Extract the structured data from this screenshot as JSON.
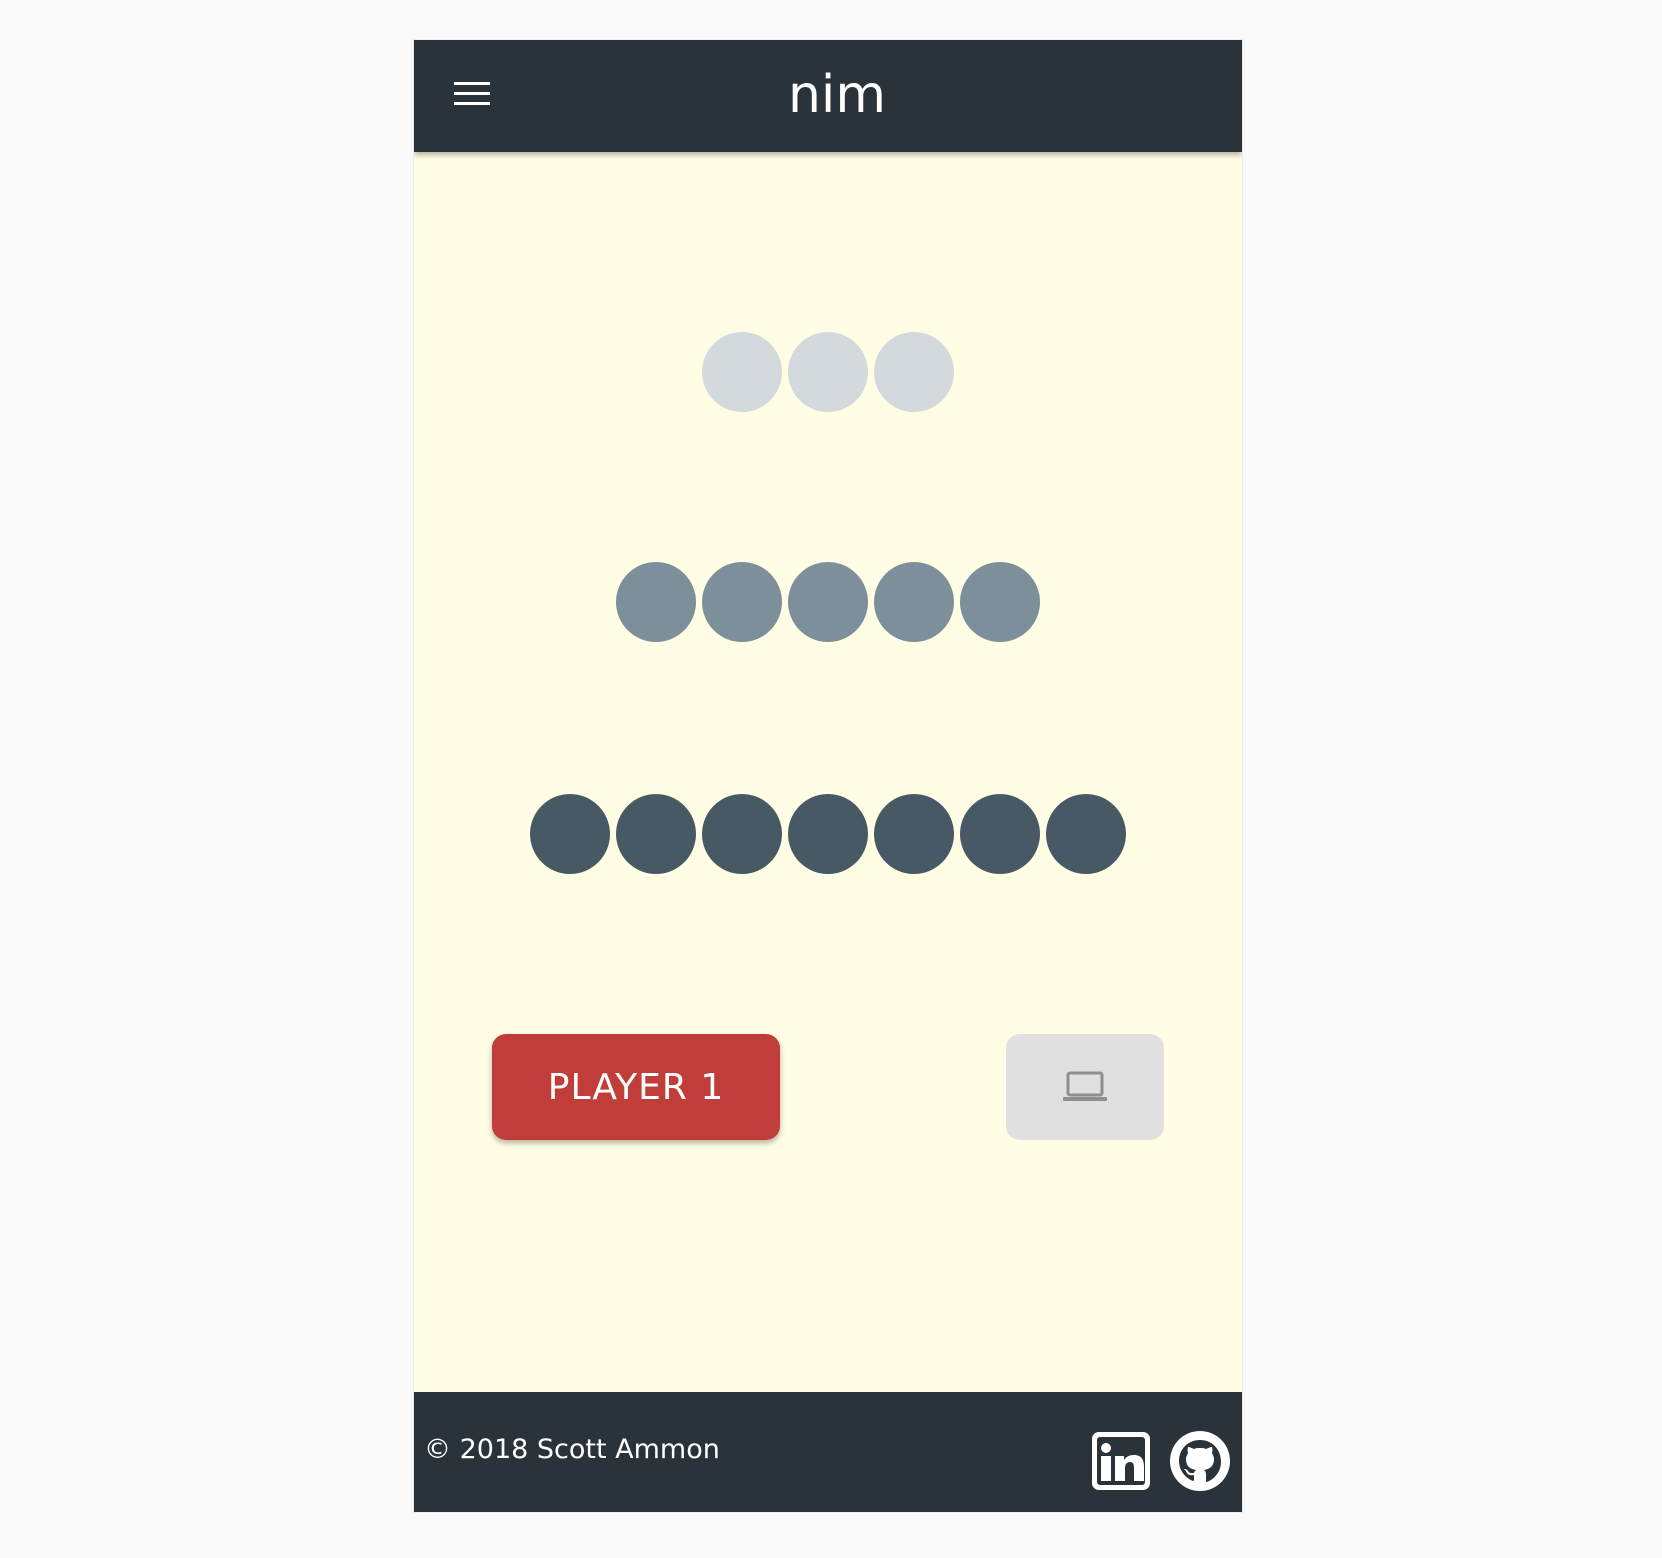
{
  "header": {
    "title": "nim",
    "menu_icon": "hamburger-menu-icon"
  },
  "colors": {
    "header_bg": "#2a323a",
    "board_bg": "#fffde3",
    "player_button": "#c13d3a",
    "computer_button": "#e0e0e0"
  },
  "piles": [
    {
      "count": 3,
      "color": "#d3d9dd"
    },
    {
      "count": 5,
      "color": "#7d8f9a"
    },
    {
      "count": 7,
      "color": "#465965"
    }
  ],
  "turn": {
    "player_label": "PLAYER 1",
    "computer_icon": "laptop-icon"
  },
  "footer": {
    "copyright": "© 2018 Scott Ammon",
    "links": [
      {
        "icon": "linkedin-icon"
      },
      {
        "icon": "github-icon"
      }
    ]
  }
}
